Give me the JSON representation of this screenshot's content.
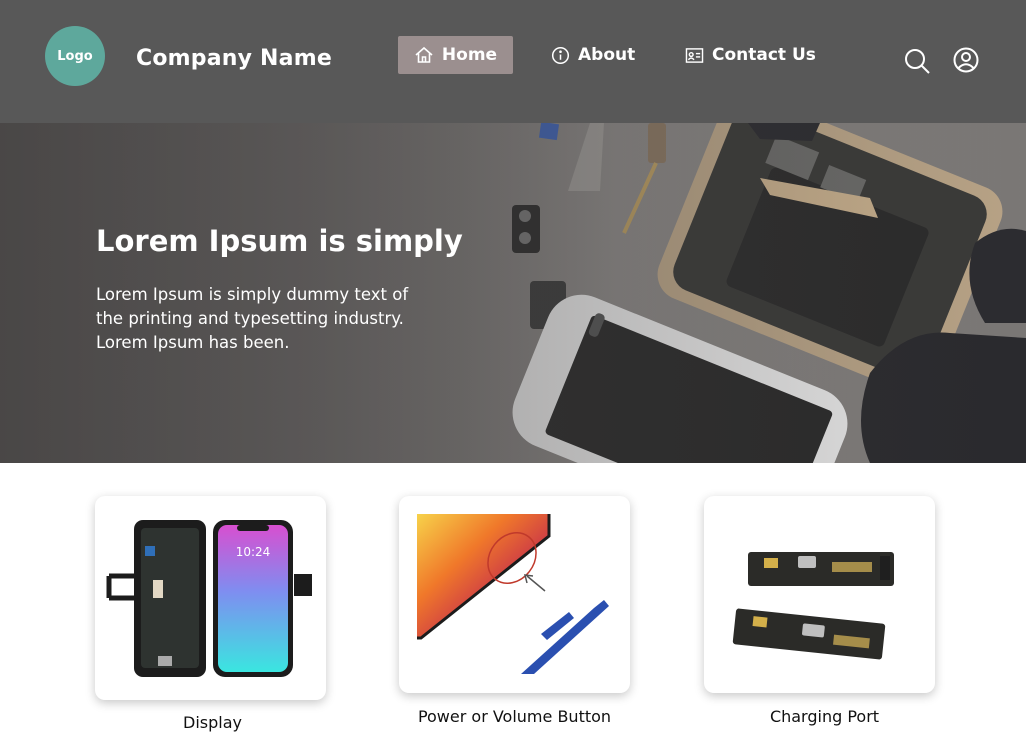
{
  "header": {
    "logo_text": "Logo",
    "company_name": "Company Name",
    "nav": [
      {
        "label": "Home",
        "icon": "home-icon",
        "active": true
      },
      {
        "label": "About",
        "icon": "info-icon",
        "active": false
      },
      {
        "label": "Contact Us",
        "icon": "contact-card-icon",
        "active": false
      }
    ],
    "actions": [
      "search-icon",
      "user-icon"
    ]
  },
  "hero": {
    "title": "Lorem Ipsum is simply",
    "text": "Lorem Ipsum is simply dummy text of the printing and typesetting industry. Lorem Ipsum has been."
  },
  "services": [
    {
      "label": "Display"
    },
    {
      "label": "Power or Volume Button"
    },
    {
      "label": "Charging Port"
    }
  ],
  "colors": {
    "header_bg": "#585858",
    "logo_bg": "#5ea89c",
    "nav_active_bg": "#9b8f8f"
  }
}
